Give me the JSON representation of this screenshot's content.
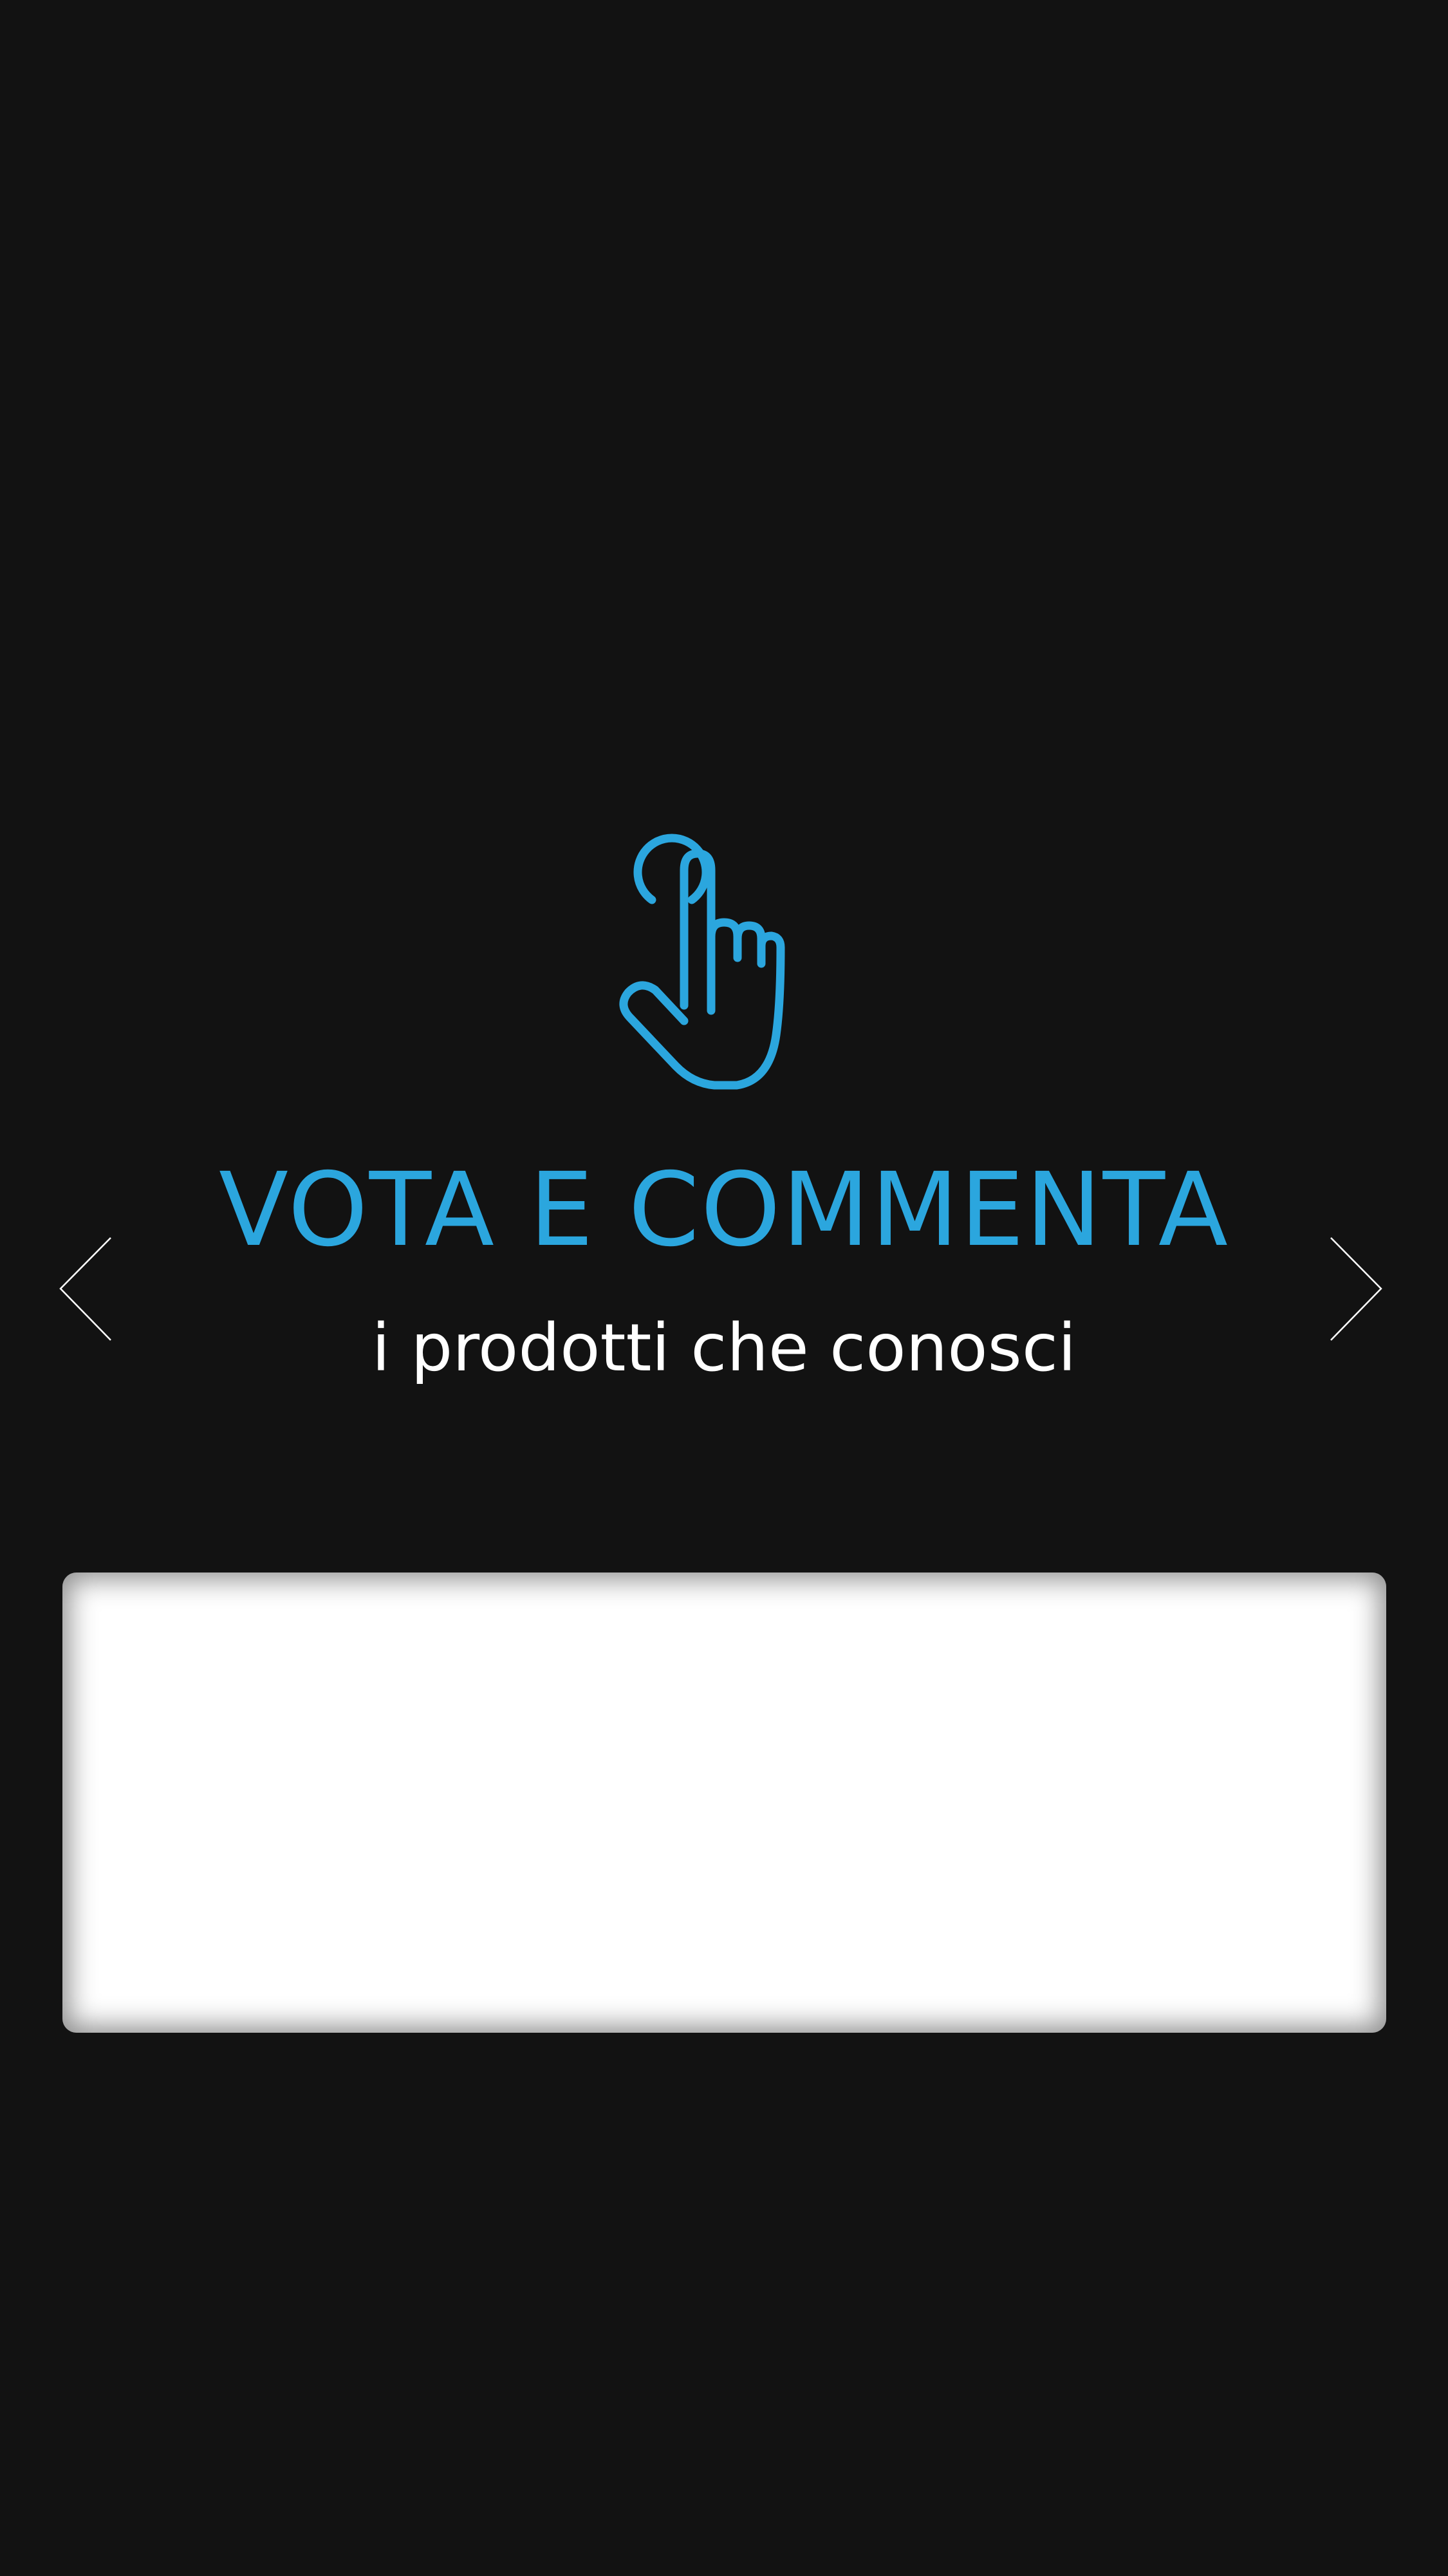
{
  "onboarding": {
    "icon": "hand-pointer-tap-icon",
    "title": "VOTA E COMMENTA",
    "subtitle": "i prodotti che conosci"
  },
  "navigation": {
    "prev_icon": "chevron-left-icon",
    "next_icon": "chevron-right-icon"
  },
  "colors": {
    "background": "#121212",
    "accent": "#2BA6DE",
    "text": "#FFFFFF",
    "card": "#FFFFFF"
  }
}
